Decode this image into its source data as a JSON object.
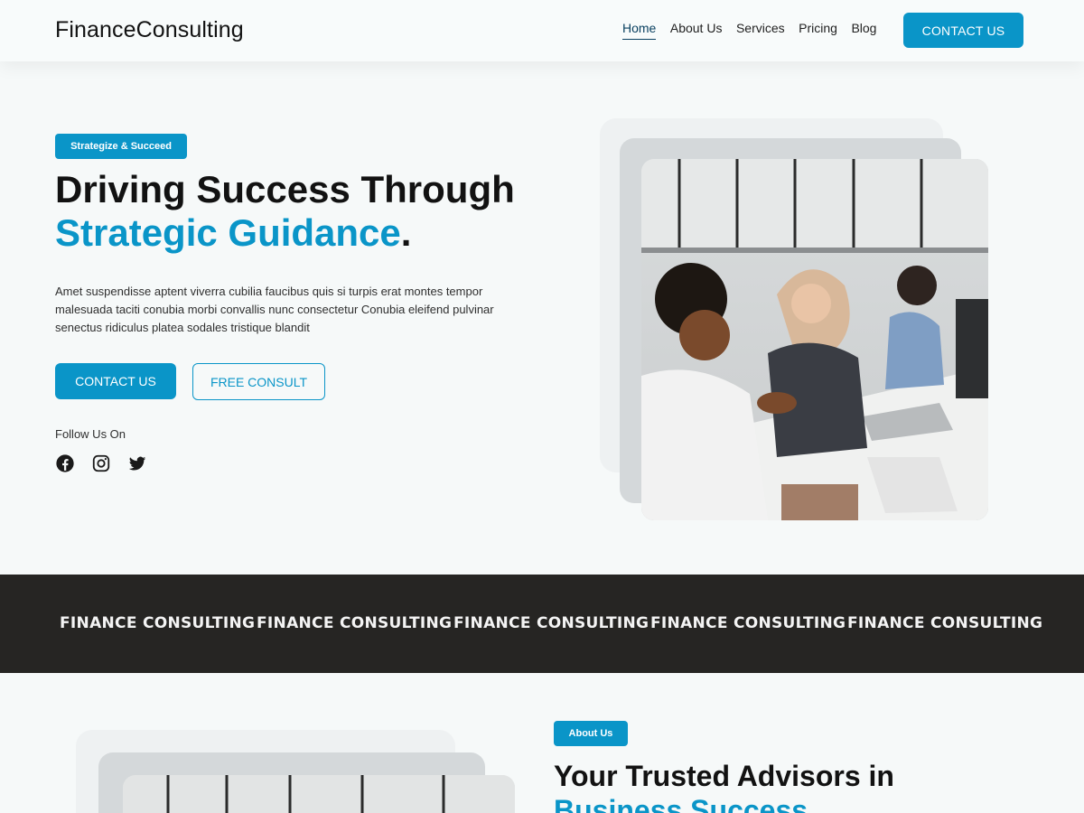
{
  "header": {
    "logo": "FinanceConsulting",
    "nav": [
      "Home",
      "About Us",
      "Services",
      "Pricing",
      "Blog"
    ],
    "active_nav": "Home",
    "cta": "CONTACT US"
  },
  "hero": {
    "badge": "Strategize & Succeed",
    "title_line1": "Driving Success Through",
    "title_accent": "Strategic Guidance",
    "title_end": ".",
    "description": "Amet suspendisse aptent viverra cubilia faucibus quis si turpis erat montes tempor malesuada taciti conubia morbi convallis nunc consectetur Conubia eleifend pulvinar senectus ridiculus platea sodales tristique blandit",
    "primary_button": "CONTACT US",
    "secondary_button": "FREE CONSULT",
    "follow_label": "Follow Us On",
    "socials": [
      "facebook-icon",
      "instagram-icon",
      "twitter-icon"
    ]
  },
  "band": {
    "items": [
      "FINANCE CONSULTING",
      "FINANCE CONSULTING",
      "FINANCE CONSULTING",
      "FINANCE CONSULTING",
      "FINANCE CONSULTING"
    ]
  },
  "about": {
    "badge": "About Us",
    "title_line1": "Your Trusted Advisors in",
    "title_accent": "Business Success"
  },
  "colors": {
    "accent": "#0a95c8",
    "dark_band": "#262523",
    "background": "#f6f9f9"
  }
}
